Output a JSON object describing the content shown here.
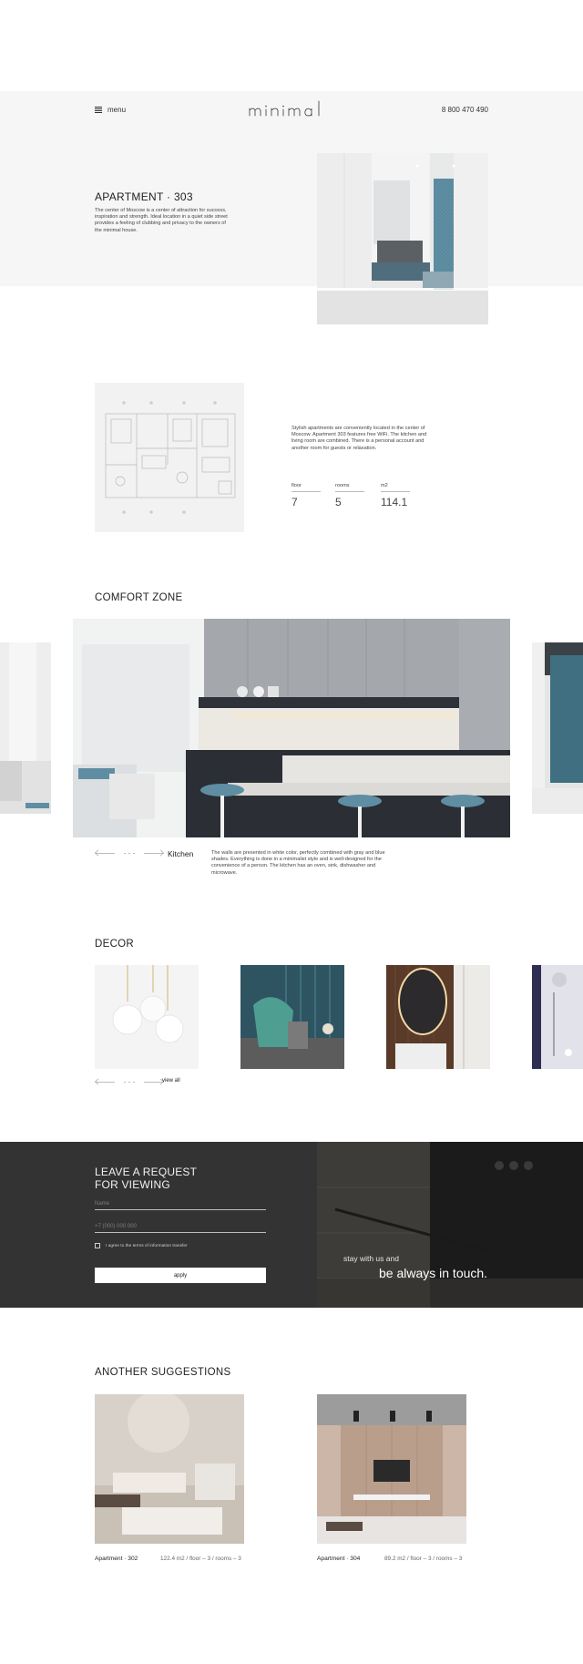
{
  "header": {
    "menu_label": "menu",
    "logo_text": "minimal",
    "phone": "8 800 470 490"
  },
  "hero": {
    "title": "APARTMENT · 303",
    "description": "The center of Moscow is a center of attraction for success, inspiration and strength. Ideal location in a quiet side street provides a feeling of clubbing and privacy to the owners of the minimal house."
  },
  "details": {
    "description": "Stylish apartments are conveniently located in the center of Moscow. Apartment 303 features free WiFi. The kitchen and living room are combined. There is a personal account and another room for guests or relaxation.",
    "stats": [
      {
        "label": "floor",
        "value": "7"
      },
      {
        "label": "rooms",
        "value": "5"
      },
      {
        "label": "m2",
        "value": "114.1"
      }
    ]
  },
  "comfort": {
    "title": "COMFORT ZONE",
    "room_name": "Kitchen",
    "room_description": "The walls are presented in white color, perfectly combined with gray and blue shades. Everything is done in a minimalist style and is well-designed for the convenience of a person. The kitchen has an oven, sink, dishwasher and microwave."
  },
  "decor": {
    "title": "DECOR",
    "view_all": "view all"
  },
  "request": {
    "title_line1": "LEAVE A REQUEST",
    "title_line2": "FOR VIEWING",
    "name_placeholder": "Name",
    "phone_placeholder": "+7 (000) 000 000",
    "agree_text": "I agree to the terms of information transfer",
    "apply_label": "apply",
    "tagline_small": "stay with us and",
    "tagline_large": "be always in touch."
  },
  "suggestions": {
    "title": "ANOTHER SUGGESTIONS",
    "items": [
      {
        "name": "Apartment · 302",
        "meta": "122.4 m2 / floor – 3 / rooms – 3"
      },
      {
        "name": "Apartment · 304",
        "meta": "89.2 m2 / floor – 3 / rooms – 3"
      }
    ]
  },
  "colors": {
    "hero_band": "#f6f6f6",
    "dark_panel": "#333333",
    "accent_blue": "#5f8ea3"
  }
}
